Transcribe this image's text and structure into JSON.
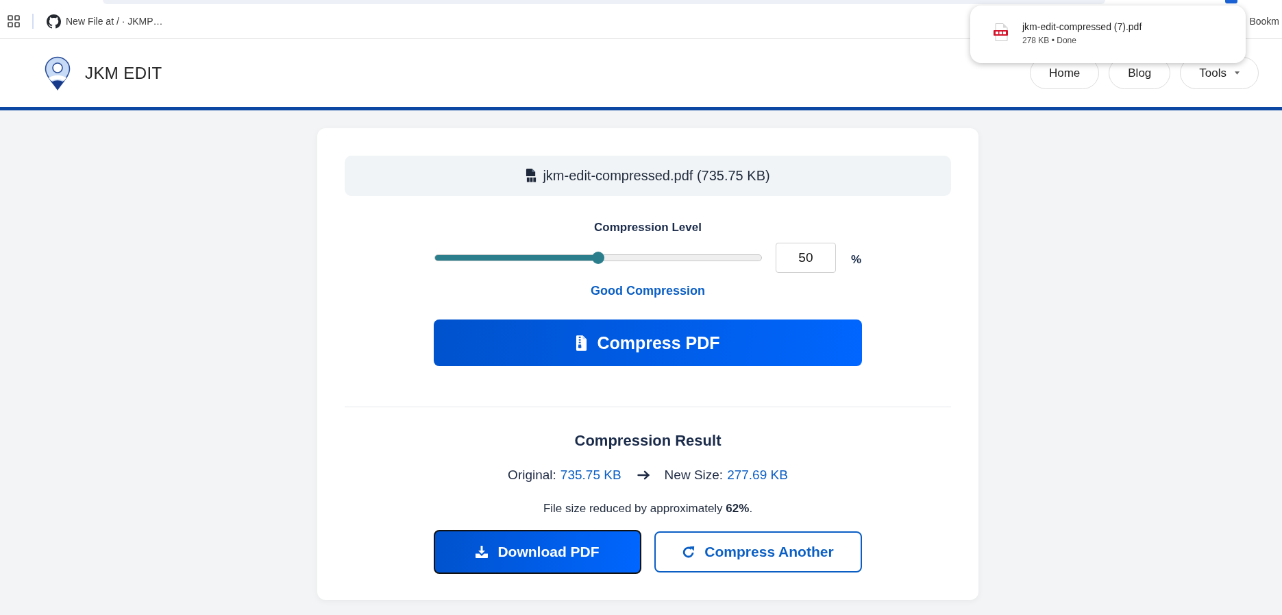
{
  "bookmarks_bar": {
    "items": [
      {
        "label": "New File at / · JKMP…"
      }
    ],
    "trailing_item": {
      "label": "Bookm"
    }
  },
  "download_popup": {
    "file_name": "jkm-edit-compressed (7).pdf",
    "details": "278 KB • Done"
  },
  "header": {
    "brand": "JKM EDIT",
    "nav": [
      {
        "label": "Home",
        "kind": "link"
      },
      {
        "label": "Blog",
        "kind": "link"
      },
      {
        "label": "Tools",
        "kind": "dropdown"
      }
    ]
  },
  "file_info": {
    "text": "jkm-edit-compressed.pdf (735.75 KB)"
  },
  "compression": {
    "label": "Compression Level",
    "level": 0.5,
    "value": "50",
    "unit": "%",
    "quality": "Good Compression",
    "button": "Compress PDF"
  },
  "result": {
    "title": "Compression Result",
    "original_label": "Original:",
    "original_value": "735.75 KB",
    "new_label": "New Size:",
    "new_value": "277.69 KB",
    "summary": "File size reduced by approximately **62%**.",
    "buttons": [
      {
        "label": "Download PDF",
        "kind": "download",
        "focused": true
      },
      {
        "label": "Compress Another",
        "kind": "restart",
        "focused": false
      }
    ]
  }
}
